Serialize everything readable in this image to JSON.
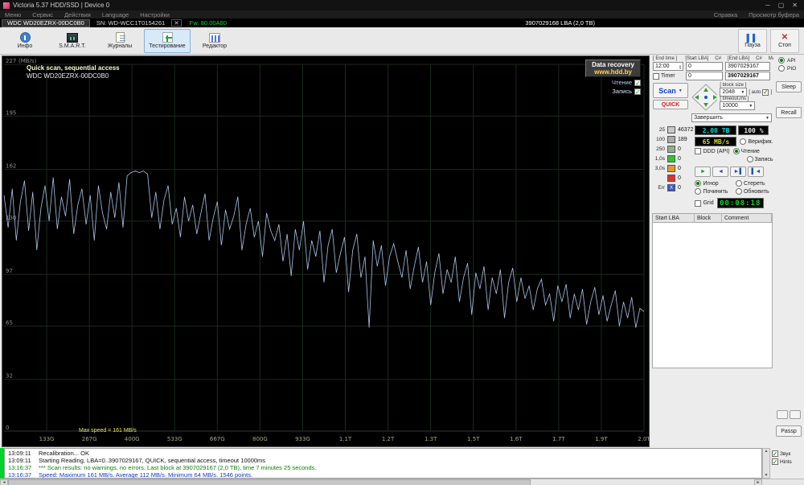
{
  "window": {
    "title": "Victoria 5.37 HDD/SSD | Device 0",
    "minimize": "─",
    "maximize": "▢",
    "close": "✕"
  },
  "menu": {
    "items": [
      "Меню",
      "Сервис",
      "Действия",
      "Language",
      "Настройки"
    ],
    "right_items": [
      "Справка",
      "Просмотр буфера"
    ]
  },
  "device_bar": {
    "model": "WDC WD20EZRX-00DC0B0",
    "serial": "SN: WD-WCC1T0154261",
    "close": "✕",
    "firmware": "Fw: 80.00A80",
    "capacity": "3907029168 LBA (2,0 TB)"
  },
  "toolbar": {
    "buttons": [
      {
        "id": "info",
        "label": "Инфо",
        "icon": "info-icon",
        "active": false
      },
      {
        "id": "smart",
        "label": "S.M.A.R.T.",
        "icon": "smart-icon",
        "active": false
      },
      {
        "id": "logs",
        "label": "Журналы",
        "icon": "logs-icon",
        "active": false
      },
      {
        "id": "test",
        "label": "Тестирование",
        "icon": "test-icon",
        "active": true
      },
      {
        "id": "editor",
        "label": "Редактор",
        "icon": "editor-icon",
        "active": false
      }
    ],
    "pause_label": "Пауза",
    "stop_label": "Стоп"
  },
  "graph": {
    "title": "Quick scan, sequential access",
    "subtitle": "WDC WD20EZRX-00DC0B0",
    "banner_line1": "Data recovery",
    "banner_line2": "www.hdd.by",
    "legend_read": "Чтение",
    "legend_write": "Запись",
    "max_note": "Max speed = 161 MB/s"
  },
  "chart_data": {
    "type": "line",
    "title": "Quick scan, sequential access",
    "ylabel": "MB/s",
    "y_unit": "(MB/s)",
    "ylim": [
      0,
      227
    ],
    "y_ticks": [
      227,
      195,
      162,
      130,
      97,
      65,
      32,
      0
    ],
    "x_ticks": [
      "133G",
      "267G",
      "400G",
      "533G",
      "667G",
      "800G",
      "933G",
      "1.1T",
      "1.2T",
      "1.3T",
      "1.5T",
      "1.6T",
      "1.7T",
      "1.9T",
      "2.0T"
    ],
    "grid": true,
    "legend_position": "top-right",
    "series": [
      {
        "name": "Чтение",
        "color": "#a9c6e8",
        "values": [
          146,
          126,
          150,
          118,
          142,
          155,
          124,
          148,
          112,
          138,
          152,
          130,
          157,
          125,
          145,
          133,
          156,
          122,
          140,
          150,
          128,
          146,
          118,
          152,
          135,
          125,
          148,
          132,
          154,
          126,
          158,
          160,
          161,
          160,
          161,
          159,
          132,
          148,
          125,
          143,
          152,
          128,
          138,
          120,
          145,
          130,
          140,
          122,
          135,
          147,
          118,
          132,
          142,
          115,
          137,
          125,
          133,
          145,
          112,
          128,
          138,
          120,
          130,
          108,
          135,
          124,
          118,
          128,
          105,
          122,
          96,
          125,
          112,
          130,
          100,
          118,
          108,
          124,
          92,
          115,
          125,
          98,
          110,
          120,
          86,
          112,
          122,
          95,
          108,
          64,
          118,
          102,
          115,
          90,
          108,
          116,
          105,
          95,
          112,
          88,
          102,
          114,
          92,
          105,
          78,
          98,
          110,
          85,
          100,
          92,
          108,
          80,
          95,
          104,
          72,
          98,
          88,
          102,
          75,
          95,
          85,
          100,
          70,
          92,
          101,
          80,
          95,
          82,
          90,
          75,
          88,
          94,
          78,
          85,
          68,
          90,
          80,
          91,
          70,
          85,
          75,
          88,
          66,
          80,
          89,
          72,
          84,
          68,
          78,
          87,
          65,
          80,
          70,
          83,
          64,
          76,
          74
        ]
      }
    ]
  },
  "panel": {
    "end_time_label": "[ End time ]",
    "end_time_value": "12:00",
    "timer_label": "Timer",
    "start_lba_label": "[Start LBA]",
    "c1_label": "C#",
    "start_lba_value": "0",
    "start_lba_value2": "0",
    "end_lba_label": "[End LBA]",
    "c2_label": "C#",
    "max_label": "MAX",
    "end_lba_value": "3907029167",
    "end_lba_value2": "3907029167",
    "scan_label": "Scan",
    "quick_label": "QUICK",
    "block_size_label": "[ block size ]",
    "block_size_value": "2048",
    "auto_label": "[ auto",
    "timeout_label": "[ timeout,ms ]",
    "timeout_value": "10000",
    "finish_select": "Завершить",
    "counters": [
      {
        "label": "25",
        "color": "#c9c9c9",
        "block_text": "",
        "count": "46372"
      },
      {
        "label": "100",
        "color": "#ababab",
        "block_text": "",
        "count": "189"
      },
      {
        "label": "250",
        "color": "#8fb08f",
        "block_text": "",
        "count": "0"
      },
      {
        "label": "1,0s",
        "color": "#35c235",
        "block_text": "",
        "count": "0"
      },
      {
        "label": "3,0s",
        "color": "#e49a26",
        "block_text": "",
        "count": "0"
      },
      {
        "label": "",
        "color": "#e03232",
        "block_text": "",
        "count": "0"
      },
      {
        "label": "Err",
        "color": "#3a55d6",
        "block_text": "X",
        "count": "0"
      }
    ],
    "size_display": "2,00 TB",
    "percent_display": "100 %",
    "speed_display": "65 MB/s",
    "ddd_label": "DDD (API)",
    "mode_radios": [
      {
        "label": "Верифик.",
        "checked": false
      },
      {
        "label": "Чтение",
        "checked": true
      },
      {
        "label": "Запись",
        "checked": false
      }
    ],
    "transport": [
      {
        "name": "play-button",
        "glyph": "►",
        "color": "#00a000"
      },
      {
        "name": "rewind-button",
        "glyph": "◄",
        "color": "#2050c0"
      },
      {
        "name": "skip-forward-button",
        "glyph": "►▌",
        "color": "#2050c0"
      },
      {
        "name": "skip-back-button",
        "glyph": "▌◄",
        "color": "#2050c0"
      }
    ],
    "action_radios": [
      {
        "label": "Игнор",
        "checked": true
      },
      {
        "label": "Стереть",
        "checked": false
      },
      {
        "label": "Починить",
        "checked": false
      },
      {
        "label": "Обновить",
        "checked": false
      }
    ],
    "grid_label": "Grid",
    "elapsed_display": "00:08:18",
    "table_headers": [
      "Start LBA",
      "Block",
      "Comment"
    ]
  },
  "side": {
    "api_label": "API",
    "pio_label": "PIO",
    "sleep_label": "Sleep",
    "recall_label": "Recall",
    "passp_label": "Passp",
    "sound_label": "Звук",
    "hints_label": "Hints"
  },
  "log": {
    "lines": [
      {
        "time": "13:09:11",
        "text": "Recalibration... OK",
        "color": "#101010"
      },
      {
        "time": "13:09:11",
        "text": "Starting Reading, LBA=0..3907029167, QUICK, sequential access, timeout 10000ms",
        "color": "#101010"
      },
      {
        "time": "13:16:37",
        "text": "*** Scan results: no warnings, no errors. Last block at 3907029167 (2,0 TB), time 7 minutes 25 seconds.",
        "color": "#0a7d0a"
      },
      {
        "time": "13:16:37",
        "text": "Speed: Maximum 161 MB/s. Average 112 MB/s. Minimum 64 MB/s. 1546 points.",
        "color": "#1536c8"
      }
    ]
  }
}
